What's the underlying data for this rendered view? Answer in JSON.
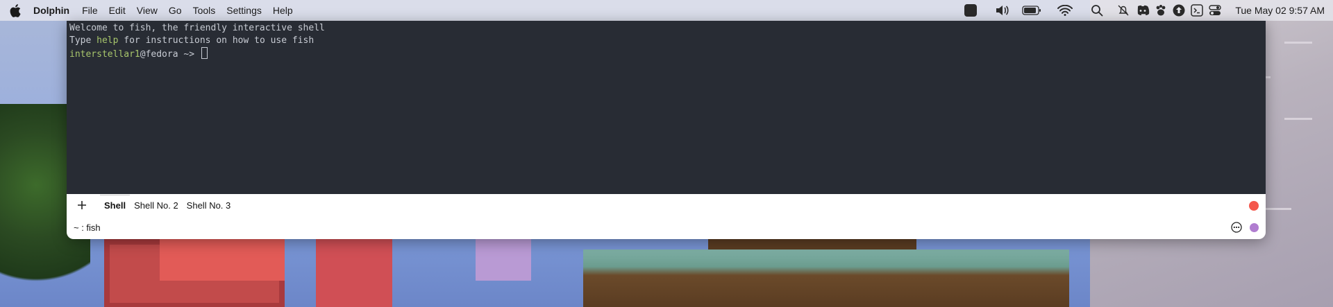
{
  "menubar": {
    "app_name": "Dolphin",
    "items": [
      "File",
      "Edit",
      "View",
      "Go",
      "Tools",
      "Settings",
      "Help"
    ],
    "clock": "Tue May 02  9:57 AM",
    "status_icons": [
      "stop-icon",
      "volume-icon",
      "battery-icon",
      "wifi-icon",
      "search-icon",
      "bell-off-icon",
      "discord-icon",
      "paw-icon",
      "upload-icon",
      "terminal-icon",
      "control-center-icon"
    ]
  },
  "terminal": {
    "welcome": "Welcome to fish, the friendly interactive shell",
    "help_prefix": "Type ",
    "help_word": "help",
    "help_suffix": " for instructions on how to use fish",
    "prompt_user": "interstellar1",
    "prompt_host": "@fedora",
    "prompt_path": " ~> "
  },
  "tabs": {
    "items": [
      {
        "label": "Shell",
        "active": true
      },
      {
        "label": "Shell No. 2",
        "active": false
      },
      {
        "label": "Shell No. 3",
        "active": false
      }
    ]
  },
  "statusbar": {
    "text": "~ : fish"
  },
  "colors": {
    "terminal_bg": "#282c34",
    "terminal_fg": "#c8ccd4",
    "accent_green": "#a8c66c",
    "close_red": "#f4574c",
    "avatar_purple": "#b07dd0"
  }
}
